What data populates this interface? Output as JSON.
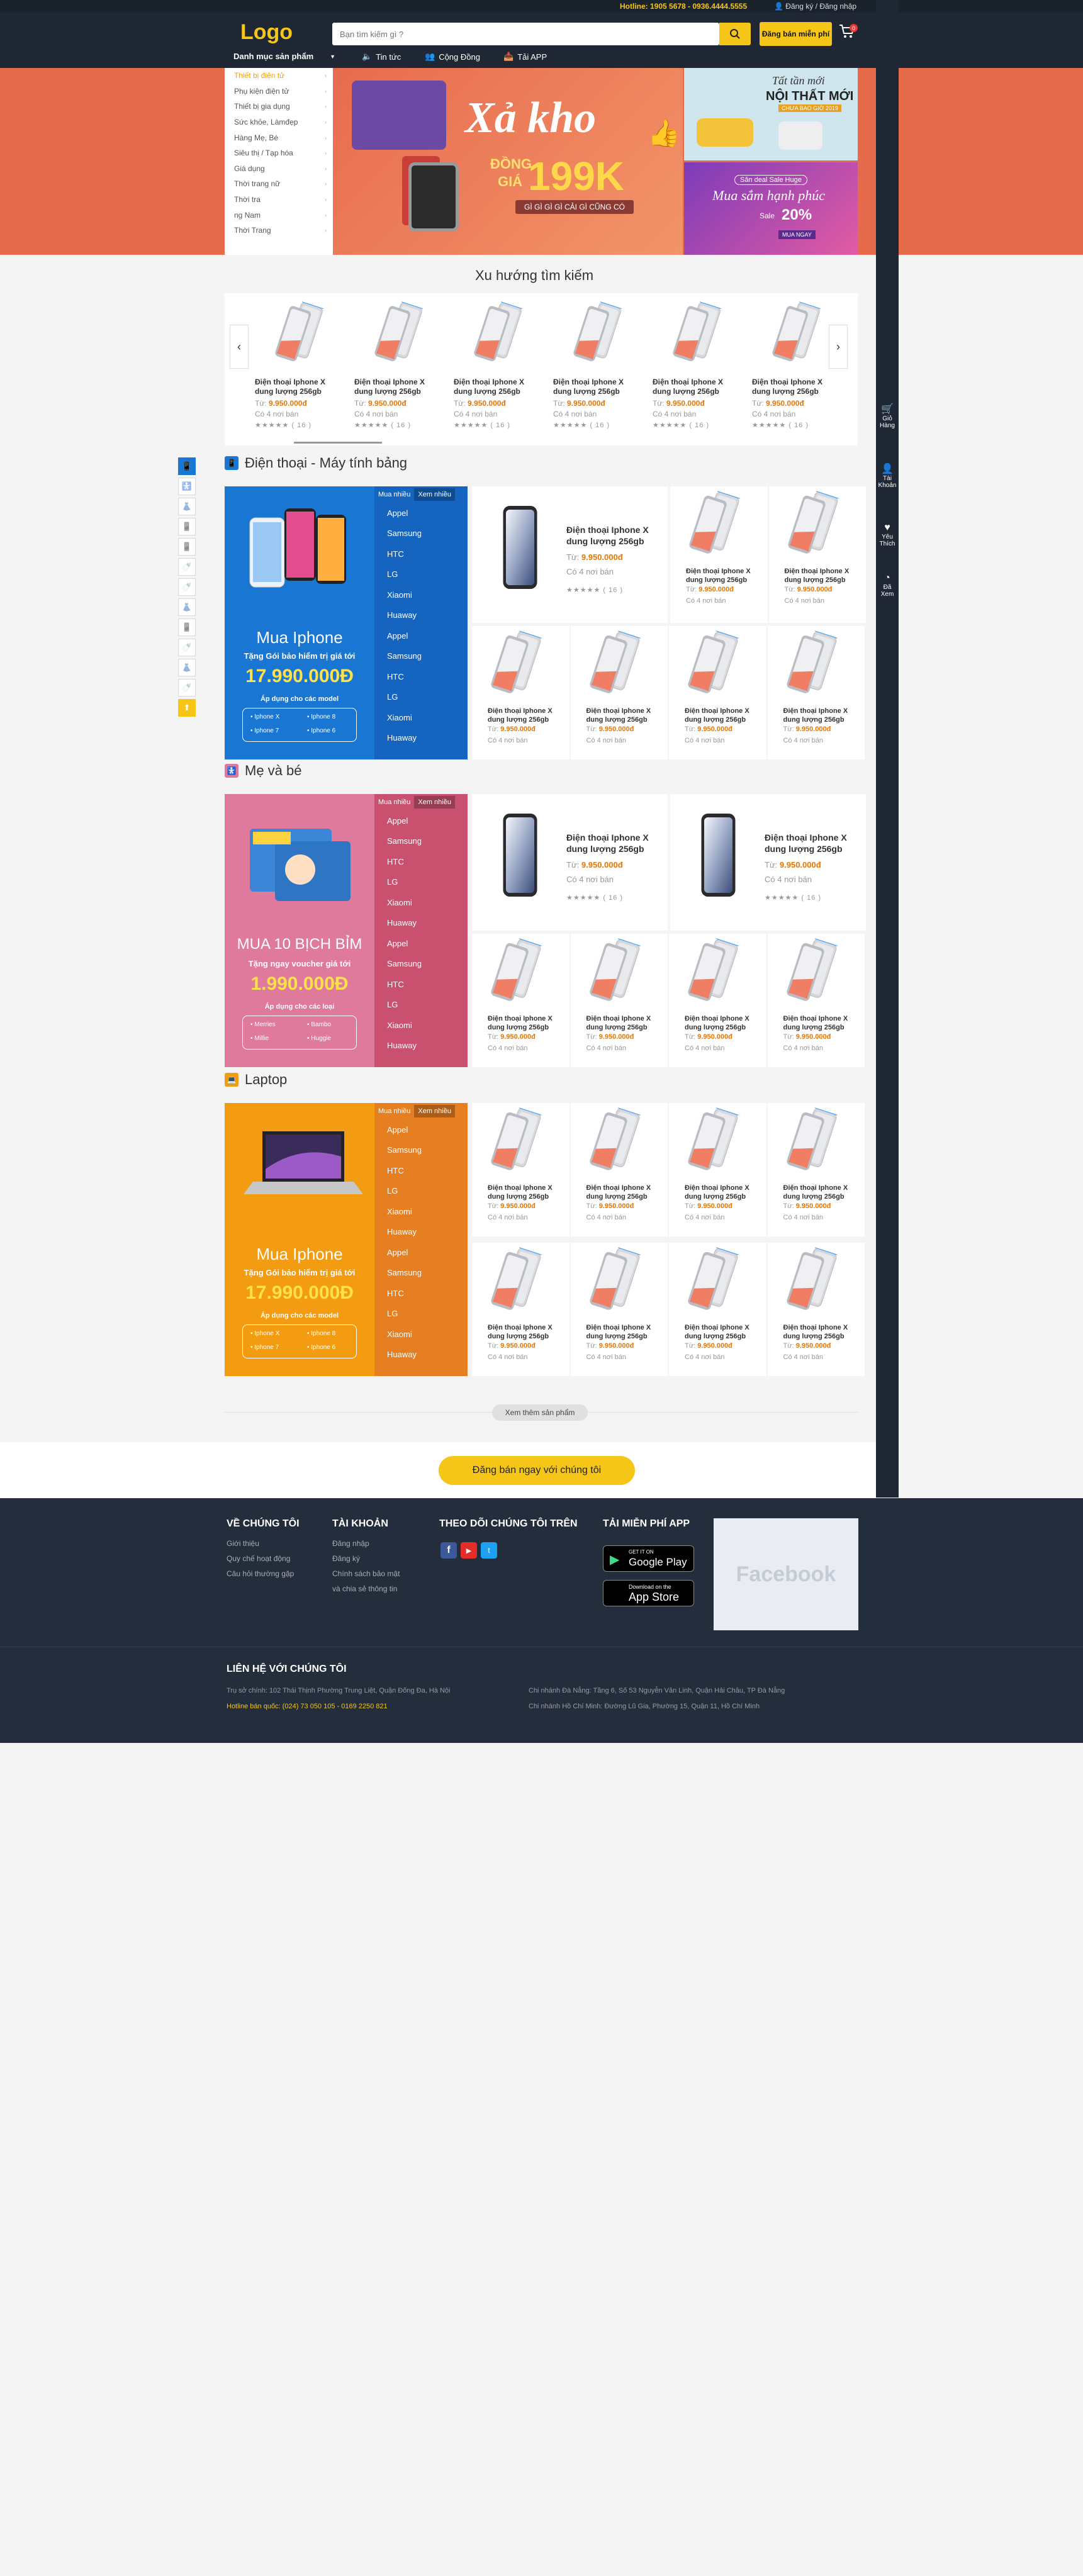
{
  "header": {
    "hotline": "Hotline: 1905 5678 - 0936.4444.5555",
    "login": "Đăng ký / Đăng nhập",
    "logo": "Logo",
    "search_placeholder": "Bạn tìm kiếm gì ?",
    "sell_button": "Đăng bán miễn phí",
    "cart_count": "0",
    "category_menu": "Danh mục sản phẩm",
    "nav": [
      "Tin tức",
      "Cộng Đồng",
      "Tải APP"
    ]
  },
  "side_menu": [
    "Thiết bị điện tử",
    "Phụ kiện điện tử",
    "Thiết bị gia dụng",
    "Sức khỏe, Làmđẹp",
    "Hàng Mẹ, Bé",
    "Siêu thị / Tạp hóa",
    "Giá dụng",
    "Thời trang nữ",
    "Thời tra",
    "ng Nam",
    "Thời Trang"
  ],
  "banner": {
    "title": "Xả kho",
    "sub1": "ĐỒNG",
    "sub2": "GIÁ",
    "price": "199K",
    "tagline": "GÌ GÌ GÌ GÌ CẢI GÌ CŨNG CÓ",
    "r1_title": "Tất tần mới",
    "r1_big": "NỘI THẤT MỚI",
    "r1_small": "CHƯA BAO GIỜ 2019",
    "r2_small": "Săn deal Sale Huge",
    "r2_title": "Mua sắm hạnh phúc",
    "r2_sale": "Sale",
    "r2_pct": "20%",
    "r2_badge": "MUA NGAY"
  },
  "trend": {
    "title": "Xu hướng tìm kiếm",
    "items": [
      {
        "name": "Điện thoại Iphone X dung lượng 256gb",
        "prefix": "Từ:",
        "price": "9.950.000đ",
        "sellers": "Có 4 nơi bán",
        "stars": "★★★★★",
        "count": "( 16 )"
      },
      {
        "name": "Điện thoại Iphone X dung lượng 256gb",
        "prefix": "Từ:",
        "price": "9.950.000đ",
        "sellers": "Có 4 nơi bán",
        "stars": "★★★★★",
        "count": "( 16 )"
      },
      {
        "name": "Điện thoại Iphone X dung lượng 256gb",
        "prefix": "Từ:",
        "price": "9.950.000đ",
        "sellers": "Có 4 nơi bán",
        "stars": "★★★★★",
        "count": "( 16 )"
      },
      {
        "name": "Điện thoại Iphone X dung lượng 256gb",
        "prefix": "Từ:",
        "price": "9.950.000đ",
        "sellers": "Có 4 nơi bán",
        "stars": "★★★★★",
        "count": "( 16 )"
      },
      {
        "name": "Điện thoại Iphone X dung lượng 256gb",
        "prefix": "Từ:",
        "price": "9.950.000đ",
        "sellers": "Có 4 nơi bán",
        "stars": "★★★★★",
        "count": "( 16 )"
      },
      {
        "name": "Điện thoại Iphone X dung lượng 256gb",
        "prefix": "Từ:",
        "price": "9.950.000đ",
        "sellers": "Có 4 nơi bán",
        "stars": "★★★★★",
        "count": "( 16 )"
      }
    ]
  },
  "right_sidebar": [
    "Giỏ Hàng",
    "Tài Khoản",
    "Yêu Thích",
    "Đã Xem"
  ],
  "sections": [
    {
      "title": "Điện thoại - Máy tính bảng",
      "tab1": "Mua nhiều",
      "tab2": "Xem nhiều",
      "promo_title": "Mua Iphone",
      "promo_sub": "Tặng Gói bảo hiểm trị giá tới",
      "promo_price": "17.990.000Đ",
      "promo_apply": "Áp dụng cho các model",
      "models": [
        "Iphone X",
        "Iphone 8",
        "Iphone 7",
        "Iphone 6"
      ]
    },
    {
      "title": "Mẹ và bé",
      "tab1": "Mua nhiều",
      "tab2": "Xem nhiều",
      "promo_title": "MUA 10 BỊCH BỈM",
      "promo_sub": "Tặng ngay voucher giá tới",
      "promo_price": "1.990.000Đ",
      "promo_apply": "Áp dụng cho các loại",
      "models": [
        "Merries",
        "Bambo",
        "Millie",
        "Huggie"
      ]
    },
    {
      "title": "Laptop",
      "tab1": "Mua nhiều",
      "tab2": "Xem nhiều",
      "promo_title": "Mua Iphone",
      "promo_sub": "Tặng Gói bảo hiểm trị giá tới",
      "promo_price": "17.990.000Đ",
      "promo_apply": "Áp dụng cho các model",
      "models": [
        "Iphone X",
        "Iphone 8",
        "Iphone 7",
        "Iphone 6"
      ]
    }
  ],
  "brands": [
    "Appel",
    "Samsung",
    "HTC",
    "LG",
    "Xiaomi",
    "Huaway",
    "Appel",
    "Samsung",
    "HTC",
    "LG",
    "Xiaomi",
    "Huaway"
  ],
  "product": {
    "name": "Điện thoại Iphone X dung lượng 256gb",
    "prefix": "Từ:",
    "price": "9.950.000đ",
    "sellers": "Có 4 nơi bán",
    "stars": "★★★★★",
    "count": "( 16 )"
  },
  "more_button": "Xem thêm sản phẩm",
  "register_button": "Đăng bán ngay với chúng tôi",
  "footer": {
    "about_title": "VỀ CHÚNG TÔI",
    "about_links": [
      "Giới thiệu",
      "Quy chế hoạt động",
      "Câu hỏi thường gặp"
    ],
    "account_title": "TÀI KHOẢN",
    "account_links": [
      "Đăng nhập",
      "Đăng ký",
      "Chính sách bảo mật",
      "và chia sẻ thông tin"
    ],
    "follow_title": "THEO DÕI CHÚNG TÔI TRÊN",
    "app_title": "TẢI MIỄN PHÍ APP",
    "google_small": "GET IT ON",
    "google_big": "Google Play",
    "apple_small": "Download on the",
    "apple_big": "App Store",
    "facebook": "Facebook",
    "contact_title": "LIÊN HỆ VỚI CHÚNG TÔI",
    "addr1": "Trụ sở chính: 102 Thái Thịnh Phường Trung Liệt, Quận Đống Đa, Hà Nội",
    "hotline": "Hotline bán quốc: (024) 73 050 105 - 0169 2250 821",
    "addr2": "Chi nhánh Đà Nẵng: Tầng 6, Số 53 Nguyễn Văn Linh, Quận Hải Châu, TP Đà Nẵng",
    "addr3": "Chi nhánh Hồ Chí Minh: Đường Lũ Gia, Phường 15, Quận 11, Hồ Chí Minh"
  },
  "colors": {
    "accent": "#f5c518",
    "navy": "#1e2733",
    "price": "#e87600",
    "blue": "#1976d2",
    "pink": "#c9516f",
    "orange": "#f08400"
  }
}
